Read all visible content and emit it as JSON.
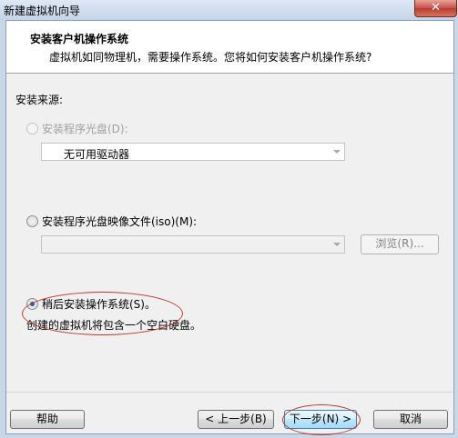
{
  "window": {
    "title": "新建虚拟机向导",
    "close_label": "✕"
  },
  "header": {
    "title": "安装客户机操作系统",
    "subtitle": "虚拟机如同物理机，需要操作系统。您将如何安装客户机操作系统?"
  },
  "install_source": {
    "label": "安装来源:",
    "option_disc": {
      "label": "安装程序光盘(D):",
      "selected": false,
      "enabled": false
    },
    "disc_combo": {
      "value": "无可用驱动器"
    },
    "option_iso": {
      "label": "安装程序光盘映像文件(iso)(M):",
      "selected": false,
      "enabled": true
    },
    "iso_combo": {
      "value": ""
    },
    "browse_label": "浏览(R)...",
    "option_later": {
      "label": "稍后安装操作系统(S)。",
      "selected": true,
      "enabled": true
    },
    "later_description": "创建的虚拟机将包含一个空白硬盘。"
  },
  "footer": {
    "help_label": "帮助",
    "back_label": "< 上一步(B)",
    "next_label": "下一步(N) >",
    "cancel_label": "取消"
  },
  "annotation_color": "#c0392b"
}
